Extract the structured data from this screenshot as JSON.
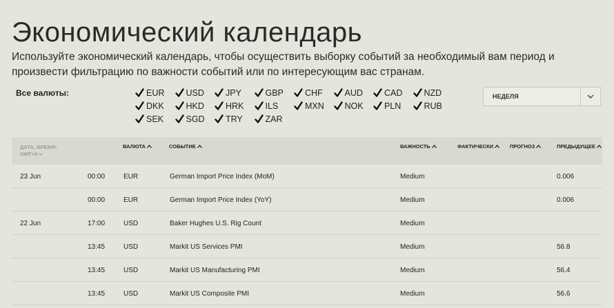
{
  "page": {
    "title": "Экономический календарь",
    "intro": "Используйте экономический календарь, чтобы осуществить выборку событий за необходимый вам период и произвести фильтрацию по важности событий или по интересующим вас странам."
  },
  "filters": {
    "label": "Все валюты:",
    "currencies": [
      "EUR",
      "USD",
      "JPY",
      "GBP",
      "CHF",
      "AUD",
      "CAD",
      "NZD",
      "DKK",
      "HKD",
      "HRK",
      "ILS",
      "MXN",
      "NOK",
      "PLN",
      "RUB",
      "SEK",
      "SGD",
      "TRY",
      "ZAR"
    ],
    "period": "НЕДЕЛЯ"
  },
  "table": {
    "headers": {
      "date_line1": "ДАТА, ВРЕМЯ:",
      "date_line2": "GMT+0",
      "currency": "ВАЛЮТА",
      "event": "СОБЫТИЕ",
      "importance": "ВАЖНОСТЬ",
      "actual": "ФАКТИЧЕСКИ",
      "forecast": "ПРОГНОЗ",
      "previous": "ПРЕДЫДУЩЕЕ"
    },
    "rows": [
      {
        "date": "23 Jun",
        "time": "00:00",
        "currency": "EUR",
        "event": "German Import Price Index (MoM)",
        "importance": "Medium",
        "actual": "",
        "forecast": "",
        "previous": "0.006"
      },
      {
        "date": "",
        "time": "00:00",
        "currency": "EUR",
        "event": "German Import Price Index (YoY)",
        "importance": "Medium",
        "actual": "",
        "forecast": "",
        "previous": "0.006"
      },
      {
        "date": "22 Jun",
        "time": "17:00",
        "currency": "USD",
        "event": "Baker Hughes U.S. Rig Count",
        "importance": "Medium",
        "actual": "",
        "forecast": "",
        "previous": ""
      },
      {
        "date": "",
        "time": "13:45",
        "currency": "USD",
        "event": "Markit US Services PMI",
        "importance": "Medium",
        "actual": "",
        "forecast": "",
        "previous": "56.8"
      },
      {
        "date": "",
        "time": "13:45",
        "currency": "USD",
        "event": "Markit US Manufacturing PMI",
        "importance": "Medium",
        "actual": "",
        "forecast": "",
        "previous": "56.4"
      },
      {
        "date": "",
        "time": "13:45",
        "currency": "USD",
        "event": "Markit US Composite PMI",
        "importance": "Medium",
        "actual": "",
        "forecast": "",
        "previous": "56.6"
      }
    ]
  }
}
